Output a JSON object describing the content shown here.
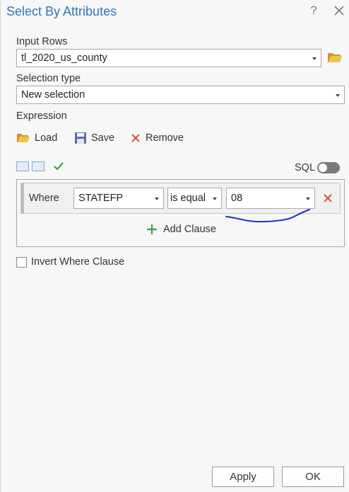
{
  "window": {
    "title": "Select By Attributes",
    "help": "?"
  },
  "input_rows": {
    "label": "Input Rows",
    "value": "tl_2020_us_county"
  },
  "selection_type": {
    "label": "Selection type",
    "value": "New selection"
  },
  "expression": {
    "label": "Expression",
    "load_label": "Load",
    "save_label": "Save",
    "remove_label": "Remove",
    "sql_label": "SQL",
    "sql_enabled": false
  },
  "clause": {
    "where_label": "Where",
    "field": "STATEFP",
    "operator": "is equal",
    "value": "08"
  },
  "add_clause_label": "Add Clause",
  "invert_label": "Invert Where Clause",
  "invert_checked": false,
  "footer": {
    "apply_label": "Apply",
    "ok_label": "OK"
  },
  "colors": {
    "title": "#2f77b8",
    "remove_red": "#d9533c",
    "add_green": "#3aa14c",
    "annotation_blue": "#1f2fd0"
  },
  "icons": [
    "close-icon",
    "folder-icon",
    "save-disk-icon",
    "remove-x-icon",
    "check-icon",
    "plus-icon"
  ]
}
